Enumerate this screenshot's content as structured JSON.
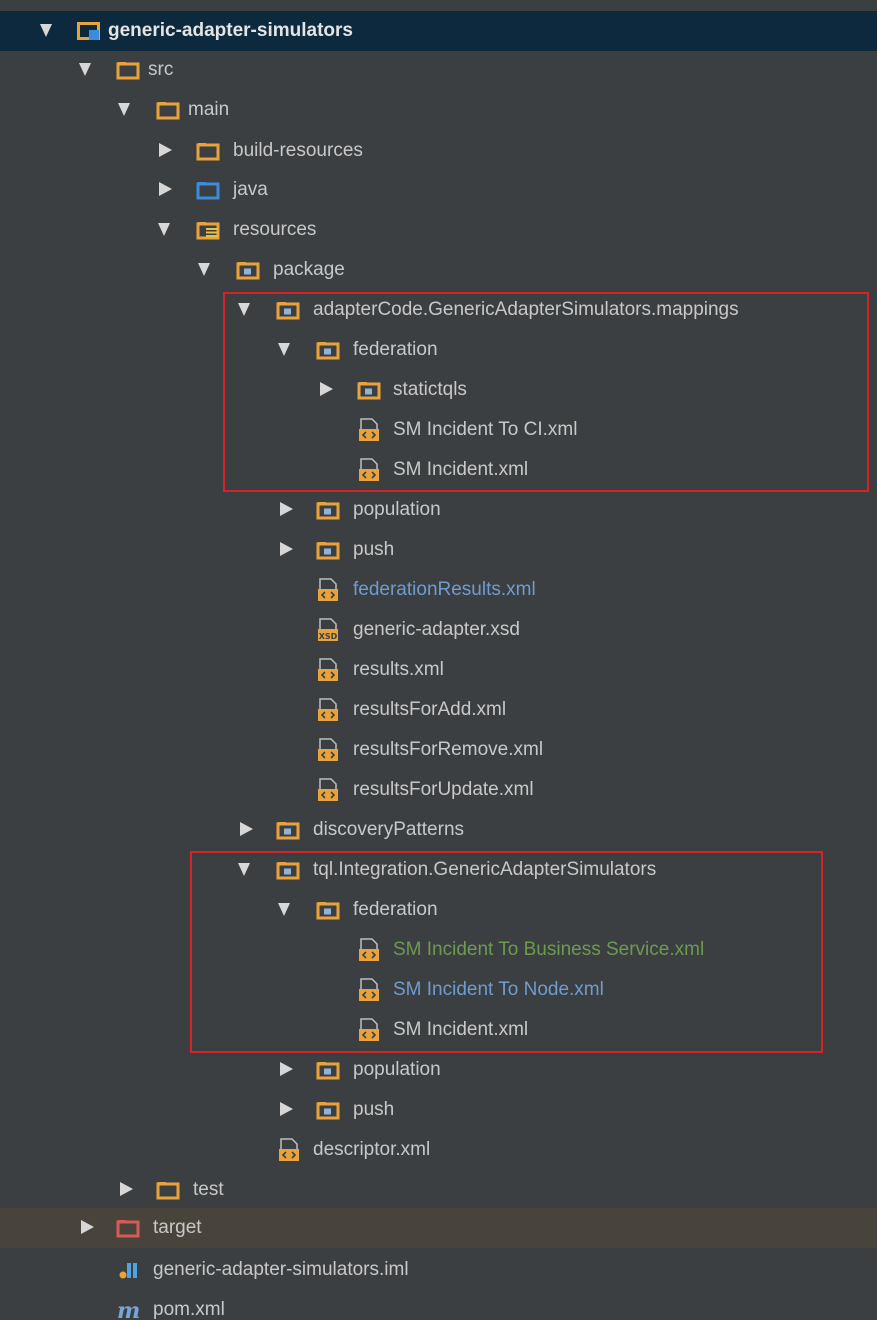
{
  "project_tree": {
    "root": "generic-adapter-simulators",
    "src": "src",
    "main": "main",
    "build_resources": "build-resources",
    "java": "java",
    "resources": "resources",
    "package": "package",
    "mappings_pkg": "adapterCode.GenericAdapterSimulators.mappings",
    "mappings_federation": "federation",
    "statictqls": "statictqls",
    "sm_incident_to_ci": "SM Incident To CI.xml",
    "sm_incident_1": "SM Incident.xml",
    "population_1": "population",
    "push_1": "push",
    "federation_results": "federationResults.xml",
    "generic_adapter_xsd": "generic-adapter.xsd",
    "results": "results.xml",
    "results_for_add": "resultsForAdd.xml",
    "results_for_remove": "resultsForRemove.xml",
    "results_for_update": "resultsForUpdate.xml",
    "discovery_patterns": "discoveryPatterns",
    "tql_pkg": "tql.Integration.GenericAdapterSimulators",
    "tql_federation": "federation",
    "sm_incident_to_business_service": "SM Incident To Business Service.xml",
    "sm_incident_to_node": "SM Incident To Node.xml",
    "sm_incident_2": "SM Incident.xml",
    "population_2": "population",
    "push_2": "push",
    "descriptor": "descriptor.xml",
    "test": "test",
    "target": "target",
    "iml_file": "generic-adapter-simulators.iml",
    "pom": "pom.xml"
  },
  "colors": {
    "background": "#3c3f41",
    "selection": "#0d293e",
    "excluded": "#49443b",
    "highlight_box": "#d5232a",
    "modified_text": "#6f9ccf",
    "added_text": "#6c9a4f"
  },
  "icons": {
    "folder": "folder-icon",
    "source_folder": "source-folder-icon",
    "resources_folder": "resources-folder-icon",
    "package": "package-icon",
    "xml_file": "xml-file-icon",
    "xsd_file": "xsd-file-icon",
    "module": "module-icon",
    "maven": "maven-icon",
    "excluded_folder": "excluded-folder-icon"
  }
}
